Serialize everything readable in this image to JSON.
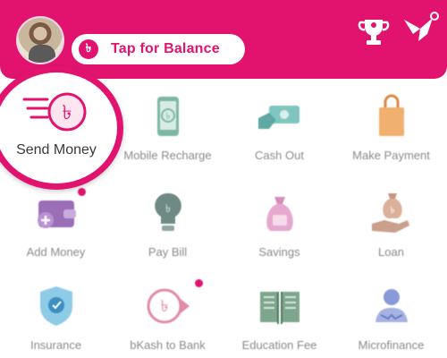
{
  "header": {
    "balance_label": "Tap for Balance",
    "taka_symbol": "৳",
    "brand_color": "#e2136e"
  },
  "highlight": {
    "label": "Send Money",
    "icon": "send-money-icon"
  },
  "services": [
    {
      "label": "Mobile Recharge",
      "icon": "mobile-recharge-icon"
    },
    {
      "label": "Cash Out",
      "icon": "cash-out-icon"
    },
    {
      "label": "Make Payment",
      "icon": "shopping-bag-icon"
    },
    {
      "label": "Add Money",
      "icon": "wallet-add-icon"
    },
    {
      "label": "Pay Bill",
      "icon": "bulb-icon"
    },
    {
      "label": "Savings",
      "icon": "savings-bag-icon"
    },
    {
      "label": "Loan",
      "icon": "loan-hand-icon"
    },
    {
      "label": "Insurance",
      "icon": "shield-icon"
    },
    {
      "label": "bKash to Bank",
      "icon": "bank-transfer-icon"
    },
    {
      "label": "Education Fee",
      "icon": "book-icon"
    },
    {
      "label": "Microfinance",
      "icon": "microfinance-icon"
    }
  ]
}
